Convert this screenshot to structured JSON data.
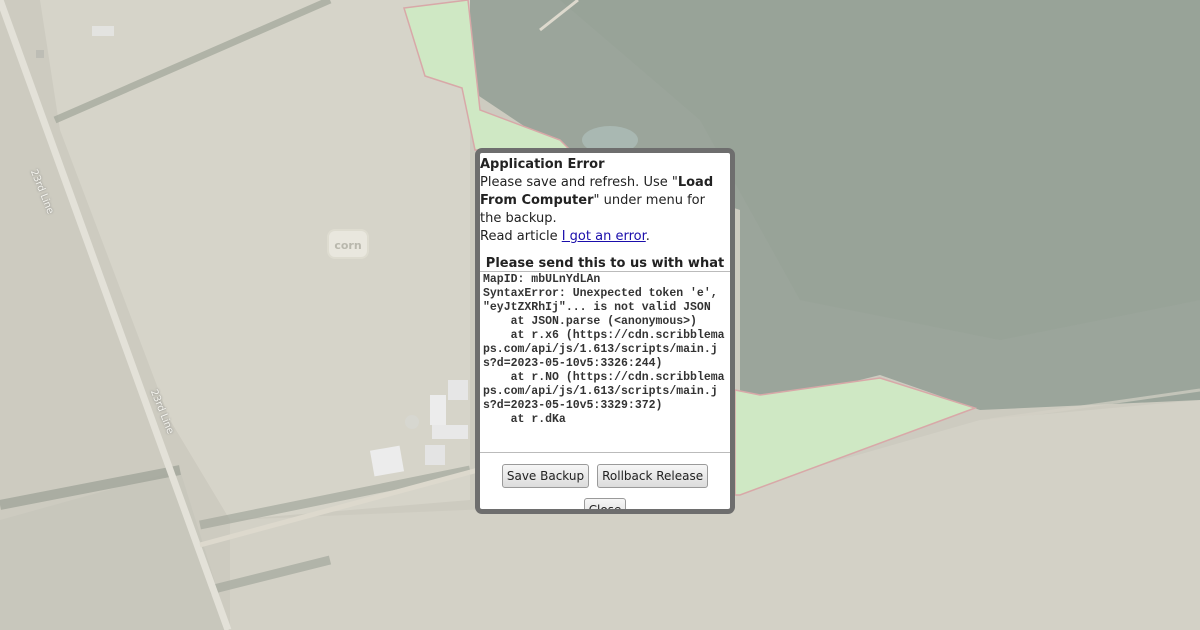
{
  "map": {
    "road_label_1": "23rd Line",
    "road_label_2": "23rd Line",
    "field_label": "corn"
  },
  "dialog": {
    "title": "Application Error",
    "msg_part1": "Please save and refresh. Use \"",
    "msg_bold": "Load From Computer",
    "msg_part2": "\" under menu for the backup.",
    "read_article_prefix": "Read article ",
    "article_link": "I got an error",
    "read_article_suffix": ".",
    "send_note": "Please send this to us with what you",
    "error_log": "MapID: mbULnYdLAn\nSyntaxError: Unexpected token 'e', \"eyJtZXRhIj\"... is not valid JSON\n    at JSON.parse (<anonymous>)\n    at r.x6 (https://cdn.scribblemaps.com/api/js/1.613/scripts/main.js?d=2023-05-10v5:3326:244)\n    at r.NO (https://cdn.scribblemaps.com/api/js/1.613/scripts/main.js?d=2023-05-10v5:3329:372)\n    at r.dKa",
    "save_backup_label": "Save Backup",
    "rollback_label": "Rollback Release",
    "close_label": "Close"
  },
  "colors": {
    "dialog_border": "#6e6e6e",
    "link": "#1a0dab",
    "field_polygon": "#cfe8c4",
    "forest": "#9aa59a"
  }
}
